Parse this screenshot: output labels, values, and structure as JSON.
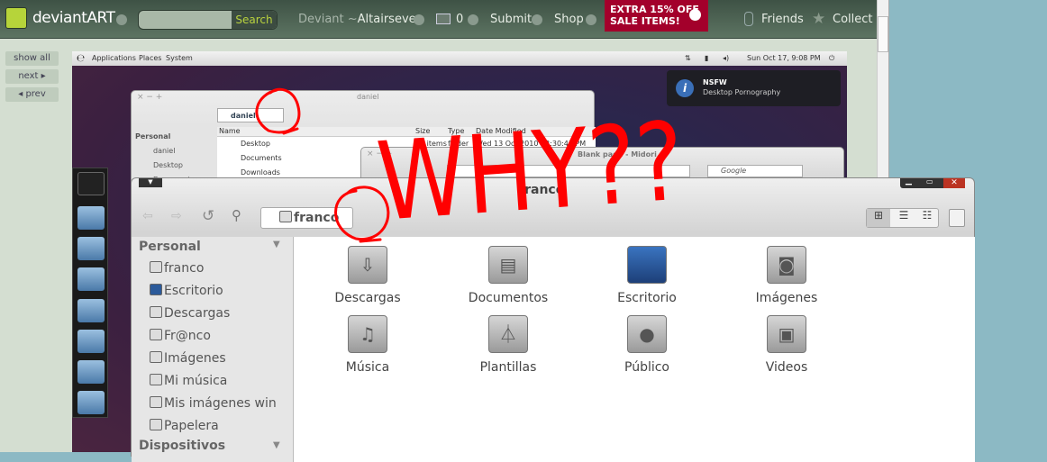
{
  "topbar": {
    "brand": "deviantART",
    "search_placeholder": "",
    "search_button": "Search",
    "deviant_prefix": "Deviant ~",
    "username": "Altairseven",
    "messages": "0",
    "submit": "Submit",
    "shop": "Shop",
    "sale": [
      "EXTRA 15% OFF",
      "SALE ITEMS!"
    ],
    "friends": "Friends",
    "collect": "Collect",
    "sale_color": "#a3002b",
    "accent": "#b6d43a"
  },
  "side_nav": {
    "show_all": "show all",
    "next": "next",
    "prev": "prev"
  },
  "desktop": {
    "panel": {
      "menus": [
        "Applications",
        "Places",
        "System"
      ],
      "clock": "Sun Oct 17,  9:08 PM"
    },
    "notification": {
      "title": "NSFW",
      "body": "Desktop Pornography"
    },
    "daniel_window": {
      "title": "daniel",
      "path": "daniel",
      "sidebar_heading": "Personal",
      "sidebar": [
        "daniel",
        "Desktop",
        "Documents"
      ],
      "columns": [
        "Name",
        "Size",
        "Type",
        "Date Modified"
      ],
      "rows": [
        {
          "name": "Desktop",
          "size": "0 items",
          "type": "folder",
          "date": "Wed 13 Oct 2010 12:30:41 PM PDT"
        },
        {
          "name": "Documents"
        },
        {
          "name": "Downloads"
        }
      ]
    },
    "midori_window": {
      "title": "Blank page - Midori",
      "search_placeholder": "Google"
    },
    "franco_window": {
      "title": "franco",
      "path": "franco",
      "sidebar_heading": "Personal",
      "sidebar": [
        "franco",
        "Escritorio",
        "Descargas",
        "Fr@nco",
        "Imágenes",
        "Mi música",
        "Mis imágenes win",
        "Papelera"
      ],
      "devices_heading": "Dispositivos",
      "folders": [
        "Descargas",
        "Documentos",
        "Escritorio",
        "Imágenes",
        "Música",
        "Plantillas",
        "Público",
        "Videos"
      ]
    }
  },
  "annotation": {
    "text": "WHY??",
    "color": "#ff0000"
  }
}
